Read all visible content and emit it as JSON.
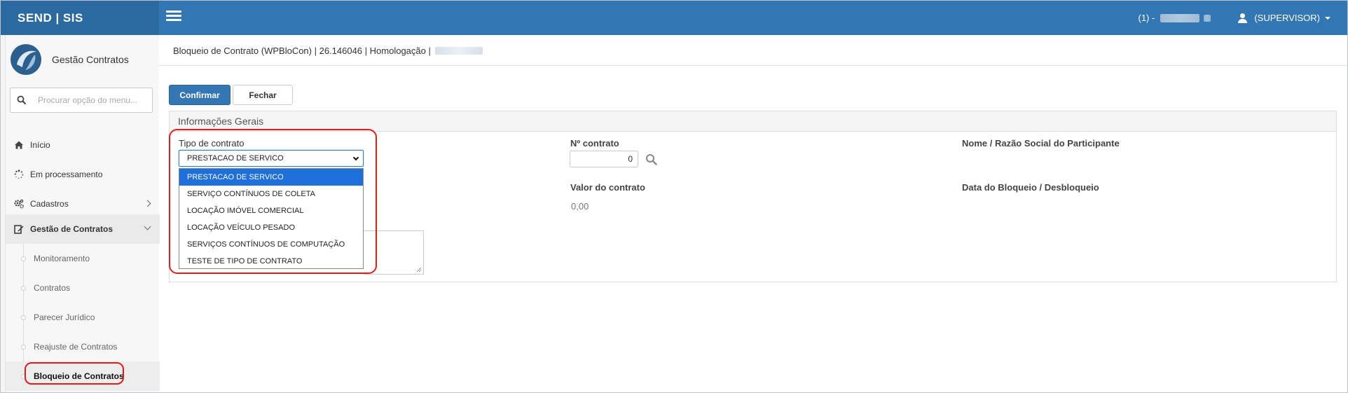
{
  "brand": "SEND | SIS",
  "topbar": {
    "env_label": "(1) -",
    "user": "(SUPERVISOR)"
  },
  "sidebar": {
    "module_name": "Gestão Contratos",
    "search_placeholder": "Procurar opção do menu...",
    "items": [
      {
        "label": "Início",
        "icon": "home-icon"
      },
      {
        "label": "Em processamento",
        "icon": "spinner-icon"
      },
      {
        "label": "Cadastros",
        "icon": "gears-icon"
      },
      {
        "label": "Gestão de Contratos",
        "icon": "edit-icon"
      }
    ],
    "submenu": [
      {
        "label": "Monitoramento"
      },
      {
        "label": "Contratos"
      },
      {
        "label": "Parecer Jurídico"
      },
      {
        "label": "Reajuste de Contratos"
      },
      {
        "label": "Bloqueio de Contratos"
      }
    ]
  },
  "page": {
    "breadcrumb": "Bloqueio de Contrato (WPBloCon) | 26.146046 | Homologação |"
  },
  "toolbar": {
    "confirm_label": "Confirmar",
    "close_label": "Fechar"
  },
  "form": {
    "section_title": "Informações Gerais",
    "tipo_label": "Tipo de contrato",
    "tipo_selected": "PRESTACAO DE SERVICO",
    "tipo_options": [
      "PRESTACAO DE SERVICO",
      "SERVIÇO CONTÍNUOS DE COLETA",
      "LOCAÇÃO IMÓVEL COMERCIAL",
      "LOCAÇÃO VEÍCULO PESADO",
      "SERVIÇOS CONTÍNUOS DE COMPUTAÇÃO",
      "TESTE DE TIPO DE CONTRATO"
    ],
    "numero_label": "Nº contrato",
    "numero_value": "0",
    "nome_label": "Nome / Razão Social do Participante",
    "valor_label": "Valor do contrato",
    "valor_value": "0,00",
    "data_label": "Data do Bloqueio / Desbloqueio"
  },
  "colors": {
    "topbar": "#3277b3",
    "brand_bg": "#2b6aa1",
    "primary": "#3277b3",
    "option_selected": "#1e6fd9",
    "highlight": "#e31b1b"
  }
}
